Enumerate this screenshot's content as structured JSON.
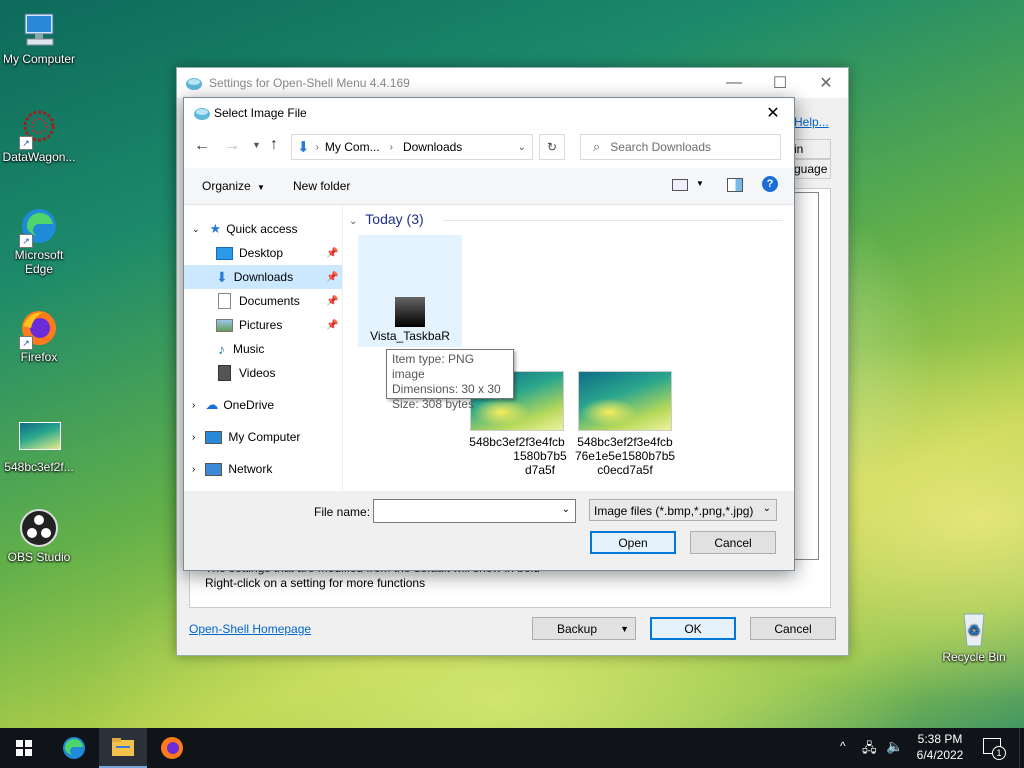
{
  "desktop": {
    "icons": [
      {
        "label": "My Computer",
        "icon": "computer-icon"
      },
      {
        "label": "DataWagon...",
        "icon": "datawagon-icon"
      },
      {
        "label": "Microsoft Edge",
        "icon": "edge-icon"
      },
      {
        "label": "Firefox",
        "icon": "firefox-icon"
      },
      {
        "label": "548bc3ef2f...",
        "icon": "image-file-icon"
      },
      {
        "label": "OBS Studio",
        "icon": "obs-icon"
      },
      {
        "label": "Recycle Bin",
        "icon": "recycle-bin-icon"
      }
    ]
  },
  "settings_window": {
    "title": "Settings for Open-Shell Menu 4.4.169",
    "help_link": "Help...",
    "tab_partial_1": "in",
    "tab_partial_2": "guage",
    "hint_line1": "The settings that are modified from the default will show in bold",
    "hint_line2": "Right-click on a setting for more functions",
    "homepage_link": "Open-Shell Homepage",
    "backup_label": "Backup",
    "ok_label": "OK",
    "cancel_label": "Cancel"
  },
  "dialog": {
    "title": "Select Image File",
    "address": {
      "segment1": "My Com...",
      "segment2": "Downloads"
    },
    "search_placeholder": "Search Downloads",
    "organize_label": "Organize",
    "new_folder_label": "New folder",
    "nav": {
      "quick_access": "Quick access",
      "desktop": "Desktop",
      "downloads": "Downloads",
      "documents": "Documents",
      "pictures": "Pictures",
      "music": "Music",
      "videos": "Videos",
      "onedrive": "OneDrive",
      "my_computer": "My Computer",
      "network": "Network"
    },
    "group_header": "Today (3)",
    "files": [
      {
        "name_line1": "Vista_TaskbaR",
        "name_line2": "",
        "name_line3": ""
      },
      {
        "name_line1": "548bc3ef2f3e4fcb",
        "name_line2": "1580b7b5",
        "name_line3": "d7a5f"
      },
      {
        "name_line1": "548bc3ef2f3e4fcb",
        "name_line2": "76e1e5e1580b7b5",
        "name_line3": "c0ecd7a5f"
      }
    ],
    "tooltip": {
      "type": "Item type: PNG image",
      "dimensions": "Dimensions: 30 x 30",
      "size": "Size: 308 bytes"
    },
    "file_name_label": "File name:",
    "file_name_value": "",
    "filter": "Image files (*.bmp,*.png,*.jpg)",
    "open_label": "Open",
    "cancel_label": "Cancel"
  },
  "taskbar": {
    "time": "5:38 PM",
    "date": "6/4/2022",
    "notification_count": "1"
  }
}
